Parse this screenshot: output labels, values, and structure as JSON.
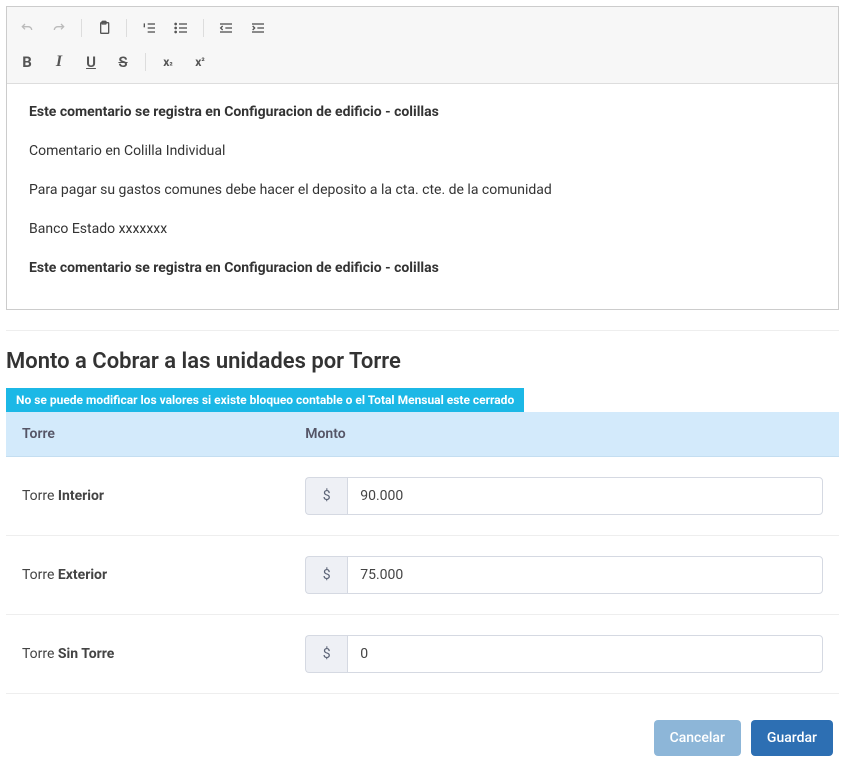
{
  "editor": {
    "lines": {
      "l1": "Este comentario se registra en Configuracion de edificio - colillas",
      "l2": "Comentario en Colilla Individual",
      "l3": "Para pagar su gastos comunes debe hacer el deposito a la cta. cte. de la comunidad",
      "l4": "Banco Estado xxxxxxx",
      "l5": "Este comentario se registra en Configuracion de edificio - colillas"
    },
    "toolbar": {
      "bold": "B",
      "italic": "I",
      "underline": "U",
      "strike": "S"
    }
  },
  "section": {
    "title": "Monto a Cobrar a las unidades por Torre",
    "alert": "No se puede modificar los valores si existe bloqueo contable o el Total Mensual este cerrado"
  },
  "table": {
    "headers": {
      "torre": "Torre",
      "monto": "Monto"
    },
    "currency_symbol": "$",
    "row_prefix": "Torre ",
    "rows": [
      {
        "name": "Interior",
        "value": "90.000"
      },
      {
        "name": "Exterior",
        "value": "75.000"
      },
      {
        "name": "Sin Torre",
        "value": "0"
      }
    ]
  },
  "actions": {
    "cancel": "Cancelar",
    "save": "Guardar"
  }
}
